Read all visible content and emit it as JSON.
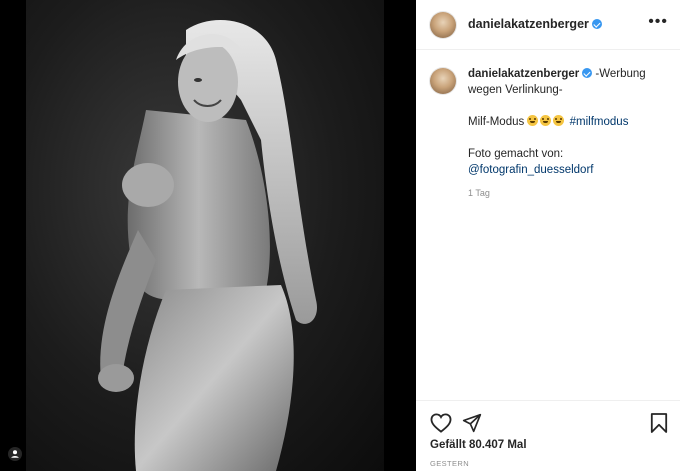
{
  "post": {
    "username": "danielakatzenberger",
    "caption": {
      "line1": "-Werbung",
      "line2": "wegen Verlinkung-",
      "line3_text": "Milf-Modus",
      "hashtag": "#milfmodus",
      "line4": "Foto gemacht von:",
      "mention": "@fotografin_duesseldorf"
    },
    "time_ago": "1 Tag",
    "likes": "Gefällt 80.407 Mal",
    "date": "GESTERN"
  },
  "icons": {
    "more": "more-options-icon",
    "like": "heart-icon",
    "share": "paper-plane-icon",
    "save": "bookmark-icon",
    "verified": "verified-badge-icon",
    "user_tag": "user-tag-icon"
  },
  "colors": {
    "verified": "#3897f0",
    "link": "#00376b",
    "text": "#262626",
    "muted": "#8e8e8e"
  }
}
